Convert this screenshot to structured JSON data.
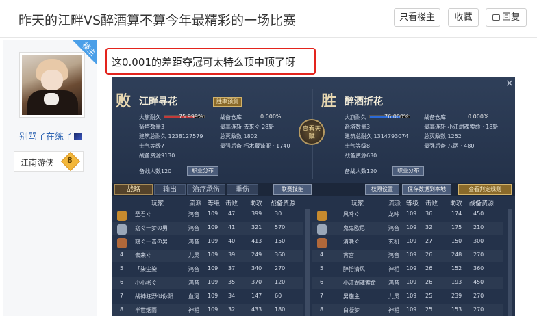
{
  "header": {
    "title": "昨天的江畔VS醉酒算不算今年最精彩的一场比赛",
    "only_host_label": "只看楼主",
    "collect_label": "收藏",
    "reply_label": "回复"
  },
  "author": {
    "badge": "楼主",
    "username": "别骂了在练了",
    "level_name": "江南游侠",
    "level_num": "8"
  },
  "post": {
    "text": "这0.001的差距夺冠可太特么顶中顶了呀"
  },
  "game": {
    "close": "×",
    "left": {
      "result": "败",
      "team": "江畔寻花",
      "hp_label": "大旗耐久",
      "hp_pct": "75.999%",
      "hp_value": 0.75999,
      "bag_label": "胜率预测",
      "stats": [
        "箭塔数量3",
        "建筑总耐久 1238127579",
        "士气等级7",
        "战备资源9130",
        "备战人数120"
      ],
      "stats2": [
        "战备仓库",
        "最高连斩 去来ぐ 28斩",
        "总灭敌数 1802",
        "最强后备 朽木藏锋亚 · 1740"
      ],
      "pct2": "0.000%",
      "dist_label": "职业分布"
    },
    "right": {
      "result": "胜",
      "team": "醉酒折花",
      "hp_label": "大旗耐久",
      "hp_pct": "76.000%",
      "hp_value": 0.76,
      "stats": [
        "箭塔数量3",
        "建筑总耐久 1314793074",
        "士气等级8",
        "战备资源630",
        "备战人数120"
      ],
      "stats2": [
        "战备仓库",
        "最高连斩 小江湖魂索命 · 18斩",
        "总灭敌数 1252",
        "最强后备 八两 · 480"
      ],
      "pct2": "0.000%",
      "dist_label": "职业分布"
    },
    "center": "查看天赋",
    "tabs": [
      "战略",
      "输出",
      "治疗承伤",
      "重伤"
    ],
    "buttons": [
      "联赛技能",
      "权限设置",
      "保存数据到本地",
      "查看判定规则"
    ],
    "columns": [
      "玩家",
      "流派",
      "等级",
      "击败",
      "助攻",
      "战备资源"
    ],
    "left_rows": [
      [
        "圣君ぐ",
        "鸿音",
        "109",
        "47",
        "399",
        "30"
      ],
      [
        "窈ぐ一梦の男",
        "鸿音",
        "109",
        "41",
        "321",
        "570"
      ],
      [
        "窈ぐ一击の男",
        "鸿音",
        "109",
        "40",
        "413",
        "150"
      ],
      [
        "去来ぐ",
        "九灵",
        "109",
        "39",
        "249",
        "360"
      ],
      [
        "「柒尘染",
        "鸿音",
        "109",
        "37",
        "340",
        "270"
      ],
      [
        "小小彬ぐ",
        "鸿音",
        "109",
        "35",
        "370",
        "120"
      ],
      [
        "战神狂野似你阳",
        "血河",
        "109",
        "34",
        "147",
        "60"
      ],
      [
        "半世烟雨",
        "神相",
        "109",
        "32",
        "433",
        "180"
      ]
    ],
    "right_rows": [
      [
        "风吟ぐ",
        "龙吟",
        "109",
        "36",
        "174",
        "450"
      ],
      [
        "鬼鬼欧尼",
        "鸿音",
        "109",
        "32",
        "175",
        "210"
      ],
      [
        "清晚ぐ",
        "玄机",
        "109",
        "27",
        "150",
        "300"
      ],
      [
        "宵宫",
        "鸿音",
        "109",
        "26",
        "248",
        "270"
      ],
      [
        "醉拾清风",
        "神相",
        "109",
        "26",
        "152",
        "360"
      ],
      [
        "小江湖魂索命",
        "鸿音",
        "109",
        "26",
        "193",
        "450"
      ],
      [
        "男施主",
        "九灵",
        "109",
        "25",
        "239",
        "270"
      ],
      [
        "白凝梦",
        "神相",
        "109",
        "25",
        "153",
        "270"
      ]
    ],
    "rank_nums": [
      "1",
      "2",
      "3",
      "4",
      "5",
      "6",
      "7",
      "8"
    ]
  }
}
